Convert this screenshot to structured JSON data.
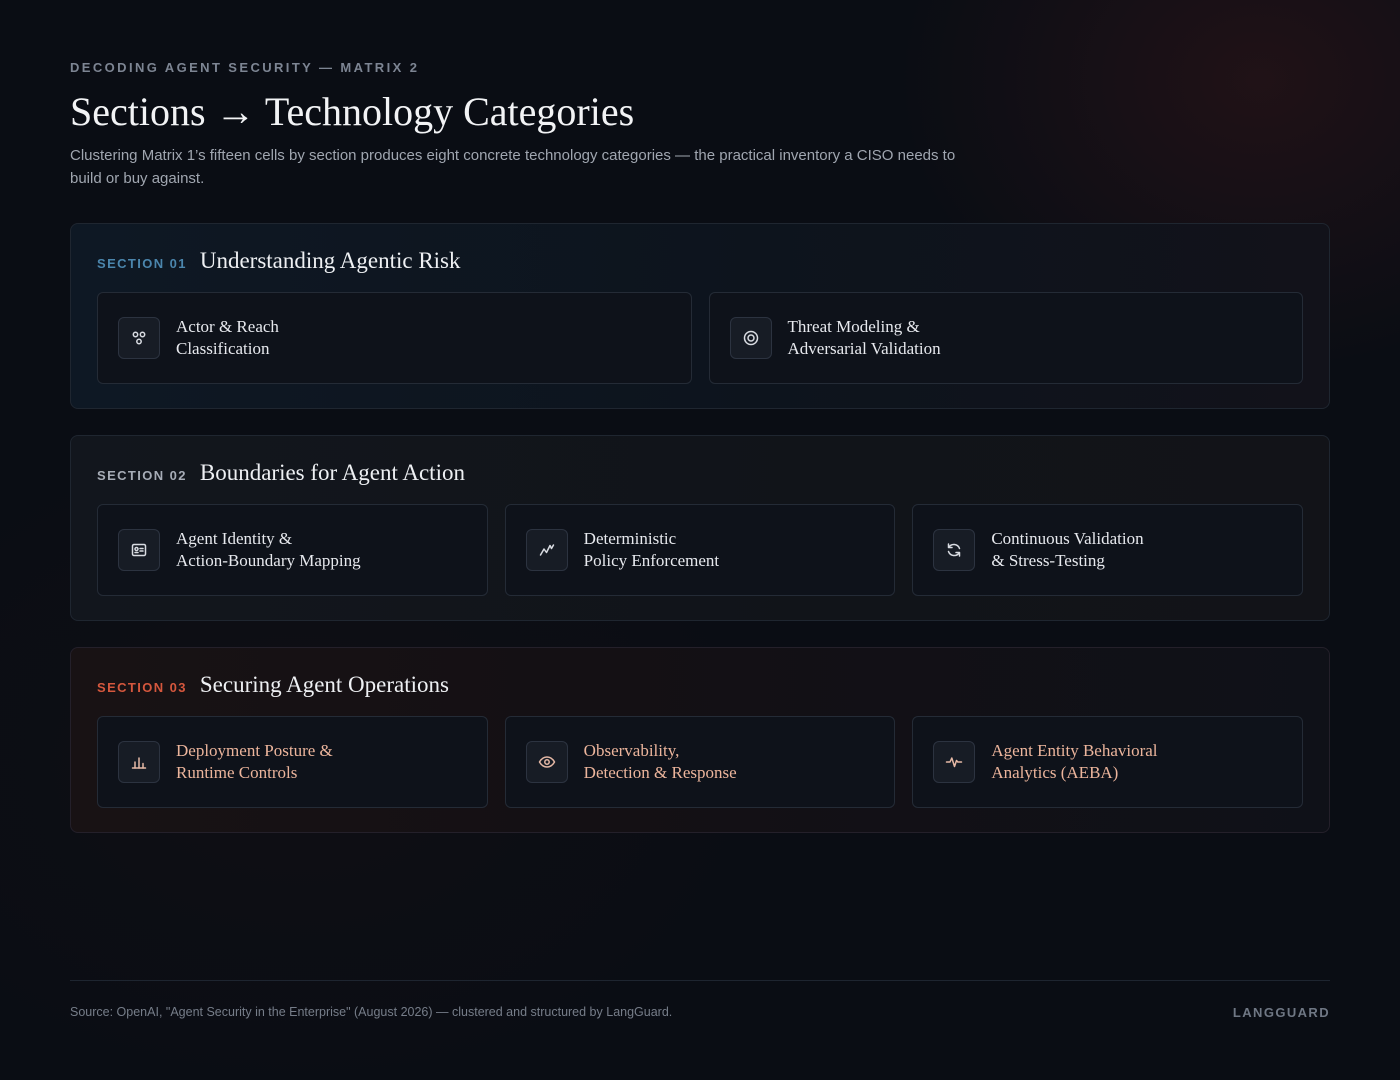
{
  "header": {
    "eyebrow": "DECODING AGENT SECURITY — MATRIX 2",
    "title": "Sections → Technology Categories",
    "subtitle": "Clustering Matrix 1’s fifteen cells by section produces eight concrete technology categories — the practical inventory a CISO needs to build or buy against."
  },
  "sections": [
    {
      "number": "SECTION 01",
      "title": "Understanding Agentic Risk",
      "accent": "#4b86ad",
      "cards": [
        {
          "icon": "actor-icon",
          "label": "Actor & Reach\nClassification"
        },
        {
          "icon": "target-icon",
          "label": "Threat Modeling &\nAdversarial Validation"
        }
      ]
    },
    {
      "number": "SECTION 02",
      "title": "Boundaries for Agent Action",
      "accent": "#a6acb6",
      "cards": [
        {
          "icon": "id-card-icon",
          "label": "Agent Identity &\nAction-Boundary Mapping"
        },
        {
          "icon": "pulse-line-icon",
          "label": "Deterministic\nPolicy Enforcement"
        },
        {
          "icon": "refresh-icon",
          "label": "Continuous Validation\n& Stress-Testing"
        }
      ]
    },
    {
      "number": "SECTION 03",
      "title": "Securing Agent Operations",
      "accent": "#d5573d",
      "cards": [
        {
          "icon": "bar-chart-icon",
          "label": "Deployment Posture &\nRuntime Controls"
        },
        {
          "icon": "eye-icon",
          "label": "Observability,\nDetection & Response"
        },
        {
          "icon": "heartbeat-icon",
          "label": "Agent Entity Behavioral\nAnalytics (AEBA)"
        }
      ]
    }
  ],
  "footer": {
    "source": "Source: OpenAI, \"Agent Security in the Enterprise\" (August 2026) — clustered and structured by LangGuard.",
    "brand": "LANGGUARD"
  }
}
